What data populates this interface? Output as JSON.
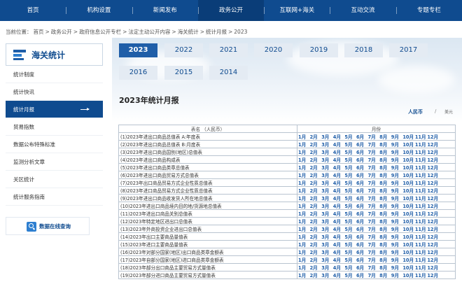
{
  "nav": [
    "首页",
    "机构设置",
    "新闻发布",
    "政务公开",
    "互联网+海关",
    "互动交流",
    "专题专栏"
  ],
  "nav_active_index": 3,
  "breadcrumb": [
    "当前位置：",
    "首页",
    ">",
    "政务公开",
    ">",
    "政府信息公开专栏",
    ">",
    "法定主动公开内容",
    ">",
    "海关统计",
    ">",
    "统计月报",
    ">",
    "2023"
  ],
  "sidebar": {
    "title": "海关统计",
    "items": [
      "统计制度",
      "统计快讯",
      "统计月报",
      "贸易指数",
      "数据公布特殊标准",
      "监测分析文章",
      "关区统计",
      "统计服务指南"
    ],
    "active_index": 2,
    "query_label": "数据在线查询"
  },
  "years": [
    "2023",
    "2022",
    "2021",
    "2020",
    "2019",
    "2018",
    "2017",
    "2016",
    "2015",
    "2014"
  ],
  "year_active": "2023",
  "section_title": "2023年统计月报",
  "currency": {
    "primary": "人民币",
    "separator": "/",
    "secondary": "美元"
  },
  "table": {
    "header_name": "表名 （人民币）",
    "header_month": "月份",
    "months": [
      "1月",
      "2月",
      "3月",
      "4月",
      "5月",
      "6月",
      "7月",
      "8月",
      "9月",
      "10月",
      "11月",
      "12月"
    ],
    "rows": [
      "(1)2023年进出口商品总值表 A:年度表",
      "(2)2023年进出口商品总值表 B:月度表",
      "(3)2023年进出口商品国别(地区)总值表",
      "(4)2023年进出口商品构成表",
      "(5)2023年进出口商品类章总值表",
      "(6)2023年进出口商品贸易方式总值表",
      "(7)2023年出口商品贸易方式企业性质总值表",
      "(8)2023年进口商品贸易方式企业性质总值表",
      "(9)2023年进出口商品收发货人所在地总值表",
      "(10)2023年进出口商品境内目的地/货源地总值表",
      "(11)2023年进出口商品关别总值表",
      "(12)2023年特定地区进出口总值表",
      "(13)2023年外商投资企业进出口总值表",
      "(14)2023年出口主要商品量值表",
      "(15)2023年进口主要商品量值表",
      "(16)2023年对部分国家(地区)出口商品类章金额表",
      "(17)2023年自部分国家(地区)进口商品类章金额表",
      "(18)2023年部分出口商品主要贸易方式量值表",
      "(19)2023年部分进口商品主要贸易方式量值表"
    ]
  }
}
